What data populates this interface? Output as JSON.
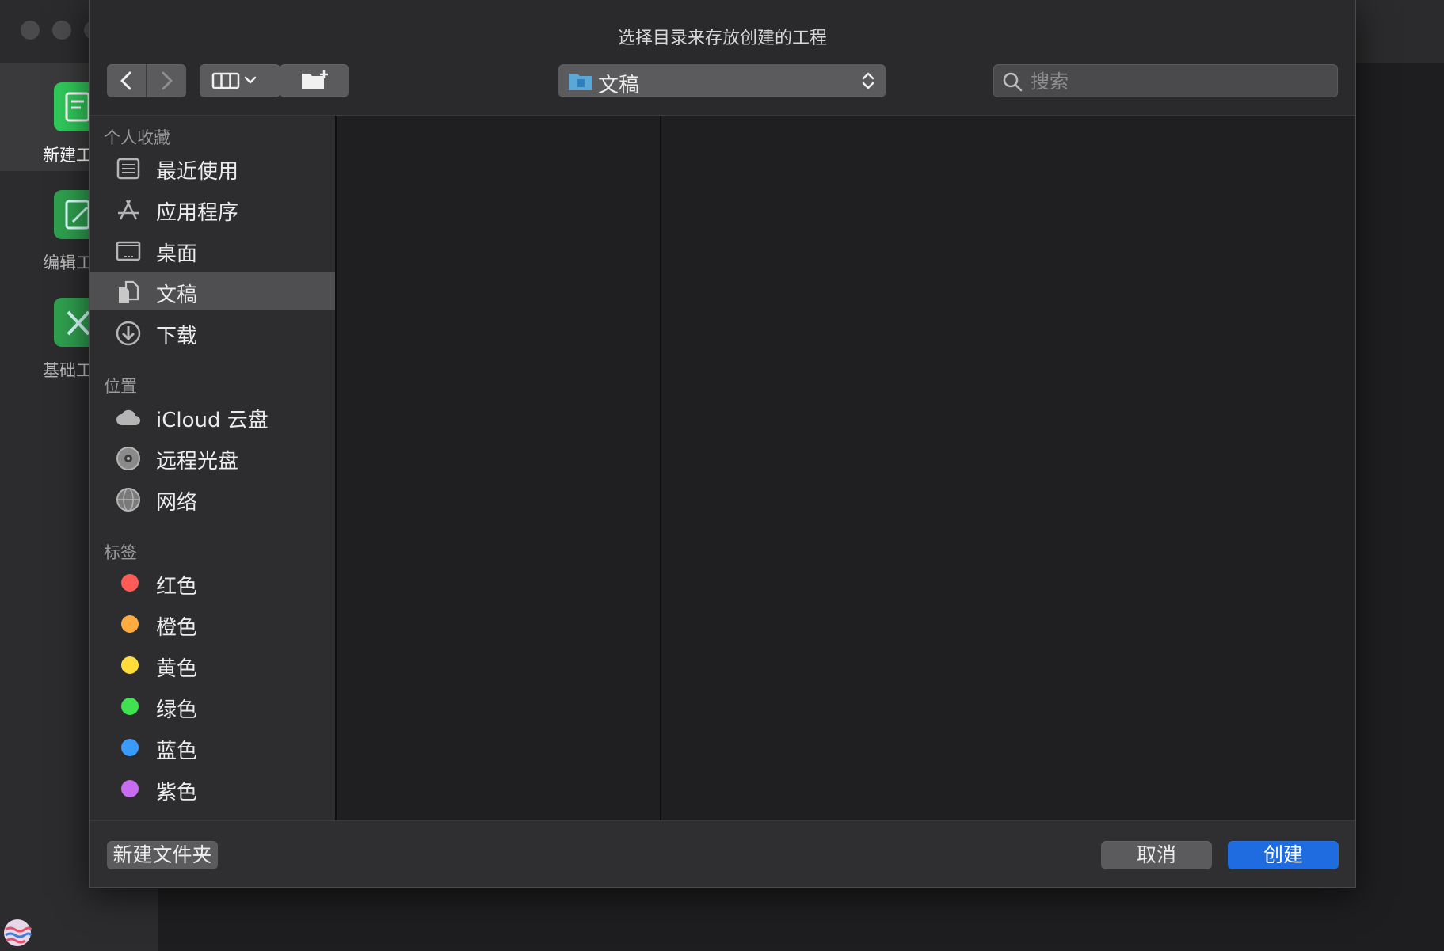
{
  "background_app": {
    "tools": [
      {
        "label": "新建工"
      },
      {
        "label": "编辑工"
      },
      {
        "label": "基础工"
      }
    ]
  },
  "dialog": {
    "title": "选择目录来存放创建的工程",
    "path_popup": {
      "current": "文稿"
    },
    "search": {
      "placeholder": "搜索",
      "value": ""
    }
  },
  "sidebar": {
    "favorites_header": "个人收藏",
    "favorites": [
      {
        "label": "最近使用",
        "icon": "recents-icon"
      },
      {
        "label": "应用程序",
        "icon": "applications-icon"
      },
      {
        "label": "桌面",
        "icon": "desktop-icon"
      },
      {
        "label": "文稿",
        "icon": "documents-icon",
        "selected": true
      },
      {
        "label": "下载",
        "icon": "downloads-icon"
      }
    ],
    "locations_header": "位置",
    "locations": [
      {
        "label": "iCloud 云盘",
        "icon": "icloud-icon"
      },
      {
        "label": "远程光盘",
        "icon": "remote-disc-icon"
      },
      {
        "label": "网络",
        "icon": "network-icon"
      }
    ],
    "tags_header": "标签",
    "tags": [
      {
        "label": "红色",
        "color": "#ff5b57"
      },
      {
        "label": "橙色",
        "color": "#ffab40"
      },
      {
        "label": "黄色",
        "color": "#ffdc3a"
      },
      {
        "label": "绿色",
        "color": "#3fe34f"
      },
      {
        "label": "蓝色",
        "color": "#3a9bff"
      },
      {
        "label": "紫色",
        "color": "#c86cf2"
      }
    ]
  },
  "footer": {
    "new_folder_label": "新建文件夹",
    "cancel_label": "取消",
    "create_label": "创建"
  },
  "colors": {
    "accent": "#1f6be0"
  }
}
